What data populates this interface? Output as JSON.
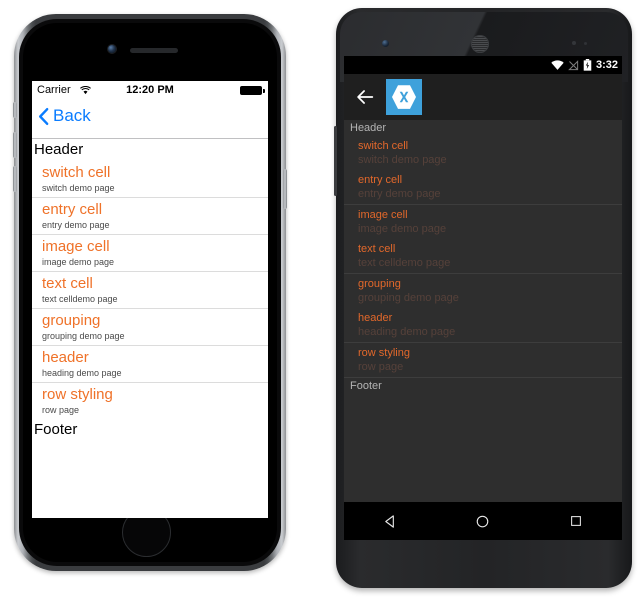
{
  "ios": {
    "status": {
      "carrier": "Carrier",
      "wifi_icon": "wifi-icon",
      "time": "12:20 PM",
      "battery_icon": "battery-full-icon"
    },
    "nav": {
      "back_label": "Back",
      "back_icon": "chevron-left-icon",
      "accent": "#0a7cff"
    },
    "list": {
      "section_header": "Header",
      "section_footer": "Footer",
      "title_color": "#ef7229",
      "detail_color": "#4a4a4a",
      "rows": [
        {
          "title": "switch cell",
          "detail": "switch demo page"
        },
        {
          "title": "entry cell",
          "detail": "entry demo page"
        },
        {
          "title": "image cell",
          "detail": "image demo page"
        },
        {
          "title": "text cell",
          "detail": "text celldemo page"
        },
        {
          "title": "grouping",
          "detail": "grouping demo page"
        },
        {
          "title": "header",
          "detail": "heading demo page"
        },
        {
          "title": "row styling",
          "detail": "row page"
        }
      ]
    }
  },
  "android": {
    "status": {
      "wifi_icon": "wifi-icon",
      "signal_icon": "no-signal-icon",
      "battery_icon": "battery-charging-icon",
      "time": "3:32"
    },
    "actionbar": {
      "back_icon": "arrow-left-icon",
      "app_logo": "xamarin-logo-icon",
      "logo_color": "#3ea1db"
    },
    "list": {
      "section_header": "Header",
      "section_footer": "Footer",
      "title_color": "#e2682b",
      "detail_color": "#56413a",
      "rows": [
        {
          "title": "switch cell",
          "detail": "switch demo page",
          "separator": false
        },
        {
          "title": "entry cell",
          "detail": "entry demo page",
          "separator": false
        },
        {
          "title": "image cell",
          "detail": "image demo page",
          "separator": true
        },
        {
          "title": "text cell",
          "detail": "text celldemo page",
          "separator": false
        },
        {
          "title": "grouping",
          "detail": "grouping demo page",
          "separator": true
        },
        {
          "title": "header",
          "detail": "heading demo page",
          "separator": false
        },
        {
          "title": "row styling",
          "detail": "row page",
          "separator": true
        }
      ]
    },
    "navbar": {
      "back_icon": "nav-back-triangle-icon",
      "home_icon": "nav-home-circle-icon",
      "recents_icon": "nav-recents-square-icon"
    }
  }
}
